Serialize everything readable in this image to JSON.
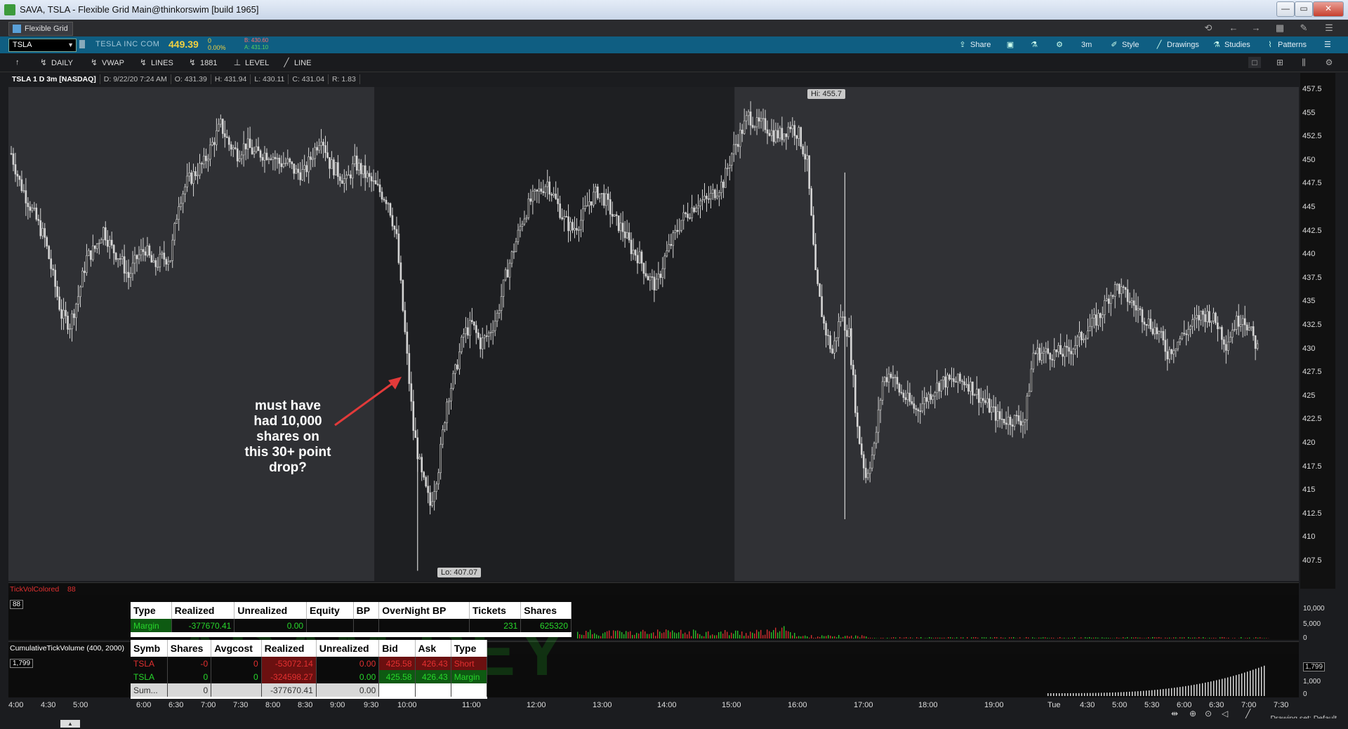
{
  "window": {
    "title": "SAVA, TSLA - Flexible Grid Main@thinkorswim [build 1965]",
    "controls": [
      "—",
      "▭",
      "✕"
    ]
  },
  "tabbar": {
    "tab_label": "Flexible Grid",
    "icons": [
      "undo-icon",
      "back-icon",
      "forward-icon",
      "grid-icon",
      "pin-icon",
      "menu-icon"
    ]
  },
  "symbol_bar": {
    "symbol": "TSLA",
    "company": "TESLA INC COM",
    "last": "449.39",
    "change": "0",
    "change_pct": "0.00%",
    "bid": "B: 430.60",
    "ask": "A: 431.10",
    "buttons": {
      "share": "Share",
      "timeframe": "3m",
      "style": "Style",
      "drawings": "Drawings",
      "studies": "Studies",
      "patterns": "Patterns"
    }
  },
  "drawing_bar": {
    "items": [
      "DAILY",
      "VWAP",
      "LINES",
      "1881",
      "LEVEL",
      "LINE"
    ]
  },
  "chart_info": {
    "header": "TSLA 1 D 3m [NASDAQ]",
    "date": "D: 9/22/20 7:24 AM",
    "open": "O: 431.39",
    "high": "H: 431.94",
    "low": "L: 430.11",
    "close": "C: 431.04",
    "range": "R: 1.83"
  },
  "annotations": {
    "hi_label": "Hi: 455.7",
    "lo_label": "Lo: 407.07",
    "note": [
      "must have",
      "had 10,000",
      "shares on",
      "this 30+ point",
      "drop?"
    ]
  },
  "price_axis": {
    "labels": [
      "457.5",
      "455",
      "452.5",
      "450",
      "447.5",
      "445",
      "442.5",
      "440",
      "437.5",
      "435",
      "432.5",
      "430",
      "427.5",
      "425",
      "422.5",
      "420",
      "417.5",
      "415",
      "412.5",
      "410",
      "407.5"
    ]
  },
  "time_axis": {
    "labels": [
      "4:00",
      "4:30",
      "5:00",
      "6:00",
      "6:30",
      "7:00",
      "7:30",
      "8:00",
      "8:30",
      "9:00",
      "9:30",
      "10:00",
      "11:00",
      "12:00",
      "13:00",
      "14:00",
      "15:00",
      "16:00",
      "17:00",
      "18:00",
      "19:00",
      "Tue",
      "4:30",
      "5:00",
      "5:30",
      "6:00",
      "6:30",
      "7:00",
      "7:30"
    ],
    "drawing_set": "Drawing set: Default"
  },
  "tick_vol": {
    "label": "TickVolColored",
    "value": "88",
    "box": "88",
    "axis": [
      "10,000",
      "5,000",
      "0"
    ]
  },
  "cum_tick": {
    "label": "CumulativeTickVolume (400, 2000)",
    "box": "1,799",
    "axis": [
      "1,799",
      "1,000",
      "0"
    ]
  },
  "account_table": {
    "headers": [
      "Type",
      "Realized",
      "Unrealized",
      "Equity",
      "BP",
      "OverNight BP",
      "Tickets",
      "Shares"
    ],
    "row": [
      "Margin",
      "-377670.41",
      "0.00",
      "",
      "",
      "",
      "231",
      "625320"
    ]
  },
  "positions_table": {
    "headers": [
      "Symb",
      "Shares",
      "Avgcost",
      "Realized",
      "Unrealized",
      "Bid",
      "Ask",
      "Type"
    ],
    "rows": [
      [
        "TSLA",
        "-0",
        "0",
        "-53072.14",
        "0.00",
        "425.58",
        "426.43",
        "Short"
      ],
      [
        "TSLA",
        "0",
        "0",
        "-324598.27",
        "0.00",
        "425.58",
        "426.43",
        "Margin"
      ],
      [
        "Sum...",
        "0",
        "",
        "-377670.41",
        "0.00",
        "",
        "",
        ""
      ]
    ]
  },
  "watermark": "ADAM REY",
  "chart_data": {
    "type": "candlestick",
    "symbol": "TSLA",
    "interval": "3m",
    "ylim": [
      406,
      458
    ],
    "high": 455.7,
    "low": 407.07,
    "sessions": [
      "pre-market",
      "regular",
      "after-hours"
    ],
    "close_path": [
      [
        0,
        451
      ],
      [
        4,
        448
      ],
      [
        8,
        446
      ],
      [
        12,
        444
      ],
      [
        16,
        442
      ],
      [
        20,
        438
      ],
      [
        24,
        434
      ],
      [
        28,
        433
      ],
      [
        32,
        436
      ],
      [
        36,
        440
      ],
      [
        40,
        441
      ],
      [
        44,
        443
      ],
      [
        48,
        441
      ],
      [
        52,
        440
      ],
      [
        56,
        438
      ],
      [
        60,
        440
      ],
      [
        64,
        441
      ],
      [
        68,
        439
      ],
      [
        72,
        440
      ],
      [
        76,
        440
      ],
      [
        80,
        446
      ],
      [
        84,
        448
      ],
      [
        88,
        449
      ],
      [
        92,
        450
      ],
      [
        96,
        452
      ],
      [
        100,
        454
      ],
      [
        104,
        452
      ],
      [
        108,
        451
      ],
      [
        112,
        452
      ],
      [
        116,
        451
      ],
      [
        120,
        451
      ],
      [
        124,
        451
      ],
      [
        128,
        450
      ],
      [
        132,
        450
      ],
      [
        136,
        449
      ],
      [
        140,
        449
      ],
      [
        144,
        451
      ],
      [
        148,
        453
      ],
      [
        152,
        450
      ],
      [
        156,
        449
      ],
      [
        160,
        448
      ],
      [
        164,
        450
      ],
      [
        168,
        449
      ],
      [
        172,
        448
      ],
      [
        176,
        447
      ],
      [
        180,
        446
      ],
      [
        184,
        442
      ],
      [
        188,
        432
      ],
      [
        192,
        422
      ],
      [
        196,
        417
      ],
      [
        200,
        414
      ],
      [
        204,
        418
      ],
      [
        208,
        425
      ],
      [
        212,
        428
      ],
      [
        216,
        432
      ],
      [
        220,
        433
      ],
      [
        224,
        431
      ],
      [
        228,
        432
      ],
      [
        232,
        434
      ],
      [
        236,
        438
      ],
      [
        240,
        441
      ],
      [
        244,
        444
      ],
      [
        248,
        446
      ],
      [
        252,
        447
      ],
      [
        256,
        448
      ],
      [
        260,
        446
      ],
      [
        264,
        444
      ],
      [
        268,
        443
      ],
      [
        272,
        444
      ],
      [
        276,
        446
      ],
      [
        280,
        447
      ],
      [
        284,
        446
      ],
      [
        288,
        444
      ],
      [
        292,
        443
      ],
      [
        296,
        441
      ],
      [
        300,
        440
      ],
      [
        304,
        438
      ],
      [
        308,
        437
      ],
      [
        312,
        440
      ],
      [
        316,
        442
      ],
      [
        320,
        444
      ],
      [
        324,
        445
      ],
      [
        328,
        446
      ],
      [
        332,
        446
      ],
      [
        336,
        447
      ],
      [
        340,
        448
      ],
      [
        344,
        451
      ],
      [
        348,
        453
      ],
      [
        352,
        455
      ],
      [
        356,
        454
      ],
      [
        360,
        454
      ],
      [
        364,
        453
      ],
      [
        368,
        453
      ],
      [
        372,
        454
      ],
      [
        376,
        453
      ],
      [
        380,
        450
      ],
      [
        384,
        438
      ],
      [
        388,
        433
      ],
      [
        392,
        430
      ],
      [
        396,
        434
      ],
      [
        400,
        432
      ],
      [
        404,
        422
      ],
      [
        408,
        417
      ],
      [
        412,
        420
      ],
      [
        416,
        427
      ],
      [
        420,
        428
      ],
      [
        424,
        426
      ],
      [
        428,
        425
      ],
      [
        432,
        424
      ],
      [
        436,
        425
      ],
      [
        440,
        426
      ],
      [
        444,
        427
      ],
      [
        448,
        427
      ],
      [
        452,
        427
      ],
      [
        456,
        427
      ],
      [
        460,
        426
      ],
      [
        464,
        425
      ],
      [
        468,
        424
      ],
      [
        472,
        423
      ],
      [
        476,
        423
      ],
      [
        480,
        423
      ],
      [
        484,
        423
      ],
      [
        488,
        430
      ],
      [
        492,
        430
      ],
      [
        496,
        430
      ],
      [
        500,
        430
      ],
      [
        504,
        430
      ],
      [
        508,
        431
      ],
      [
        512,
        432
      ],
      [
        516,
        433
      ],
      [
        520,
        434
      ],
      [
        524,
        436
      ],
      [
        528,
        437
      ],
      [
        532,
        436
      ],
      [
        536,
        435
      ],
      [
        540,
        434
      ],
      [
        544,
        433
      ],
      [
        548,
        432
      ],
      [
        552,
        430
      ],
      [
        556,
        431
      ],
      [
        560,
        432
      ],
      [
        564,
        433
      ],
      [
        568,
        434
      ],
      [
        572,
        434
      ],
      [
        576,
        433
      ],
      [
        580,
        431
      ],
      [
        584,
        433
      ],
      [
        588,
        434
      ],
      [
        592,
        432
      ],
      [
        596,
        430
      ]
    ],
    "spikes": [
      {
        "x": 398,
        "high": 449,
        "low": 412.5
      },
      {
        "x": 194,
        "high": 420,
        "low": 407.07
      }
    ]
  }
}
